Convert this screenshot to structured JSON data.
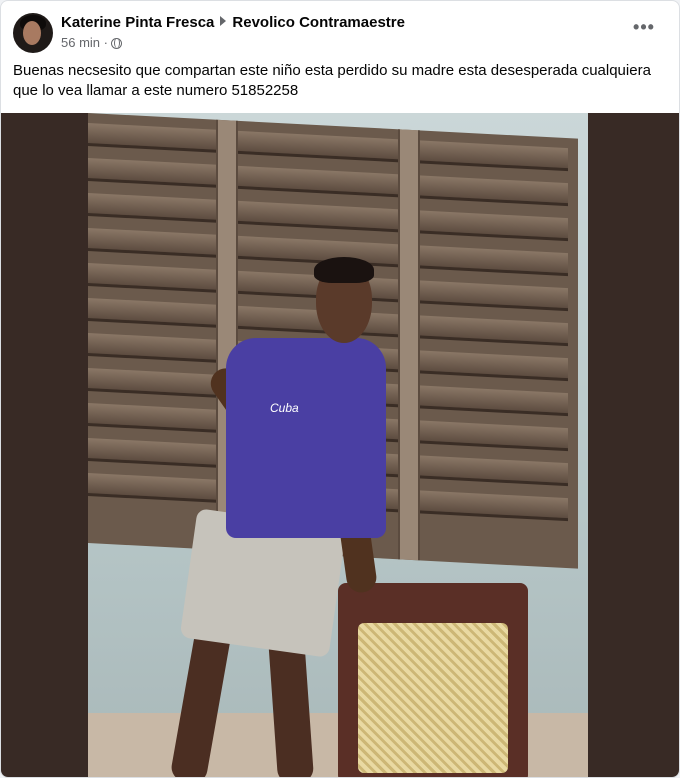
{
  "post": {
    "author": "Katerine Pinta Fresca",
    "group": "Revolico Contramaestre",
    "time": "56 min ·",
    "more_label": "•••",
    "text": "Buenas necsesito que compartan este niño esta perdido su madre esta desesperada cualquiera que lo vea llamar a este numero 51852258"
  },
  "photo": {
    "shirt_print": "Cuba"
  },
  "icons": {
    "audience": "globe-icon",
    "separator": "play-arrow-icon",
    "menu": "more-horizontal-icon"
  },
  "colors": {
    "background": "#f0f2f5",
    "card": "#ffffff",
    "primary_text": "#050505",
    "secondary_text": "#65676b",
    "photo_backdrop": "#382a25"
  }
}
